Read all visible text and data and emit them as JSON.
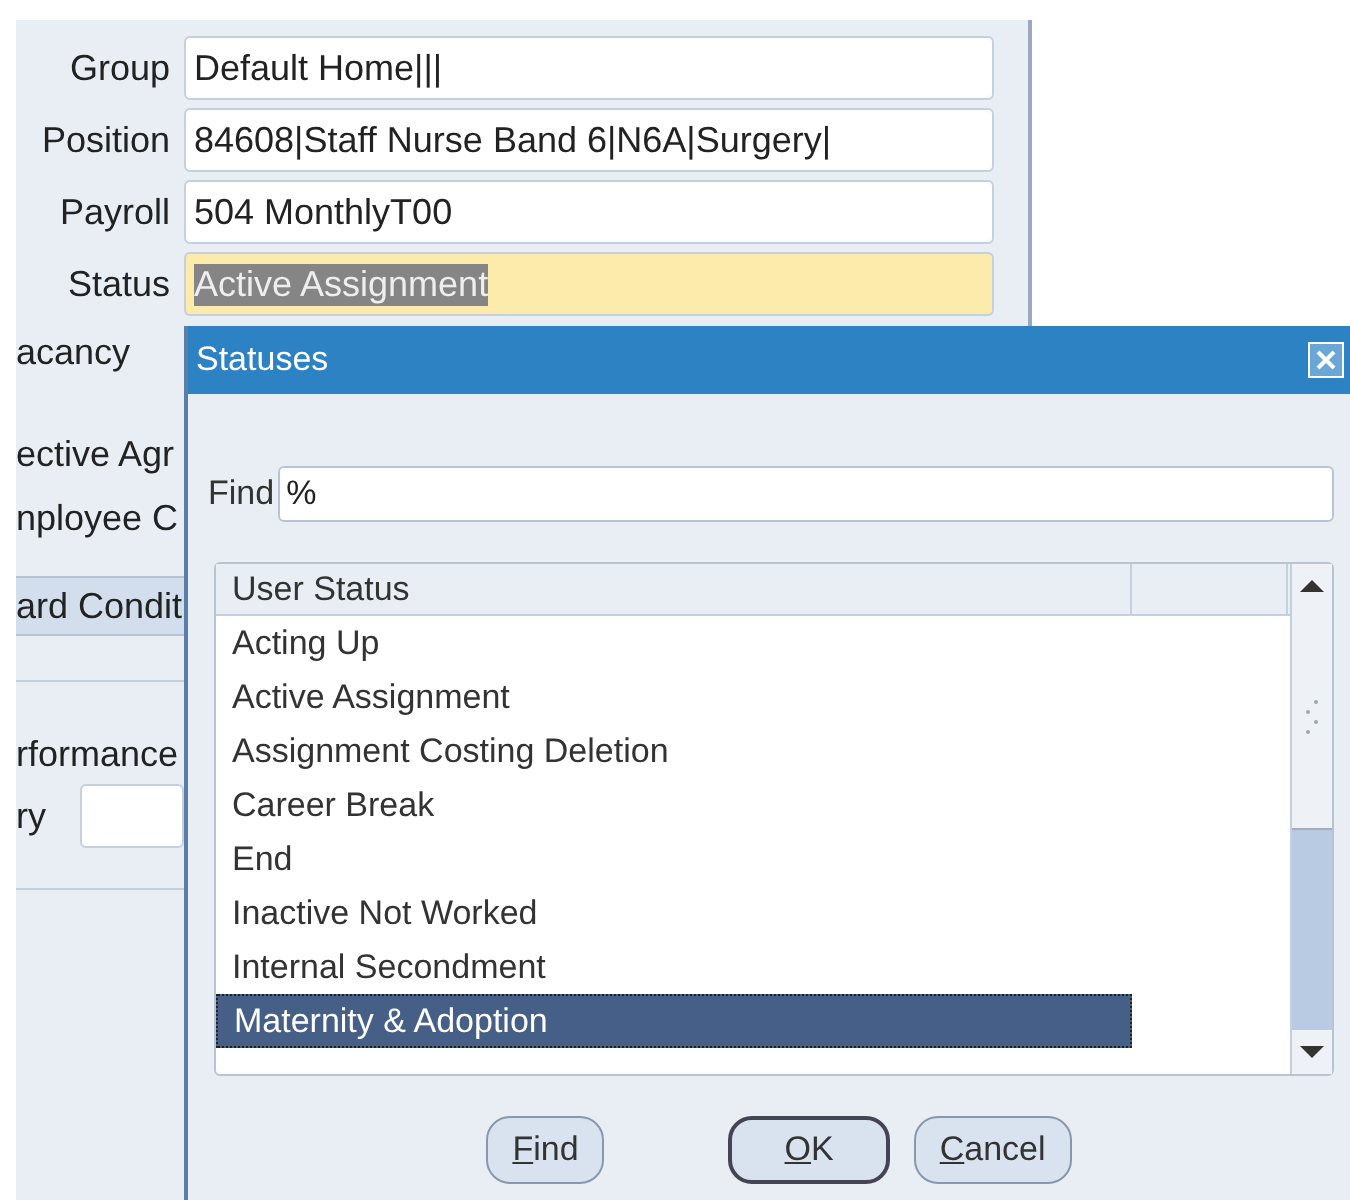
{
  "form": {
    "fields": [
      {
        "label": "Group",
        "value": "Default Home|||",
        "focused": false
      },
      {
        "label": "Position",
        "value": "84608|Staff Nurse Band 6|N6A|Surgery|",
        "focused": false
      },
      {
        "label": "Payroll",
        "value": "504 MonthlyT00",
        "focused": false
      },
      {
        "label": "Status",
        "value": "Active Assignment",
        "focused": true
      }
    ],
    "hidden_labels": [
      "acancy",
      "ective Agr",
      "nployee C"
    ],
    "tab": "ard Condit",
    "section_label": "rformance",
    "field_label": "ry"
  },
  "dialog": {
    "title": "Statuses",
    "find": {
      "label": "Find",
      "value": "%"
    },
    "list": {
      "columns": [
        "User Status"
      ],
      "rows": [
        {
          "text": "Acting Up",
          "selected": false
        },
        {
          "text": "Active Assignment",
          "selected": false
        },
        {
          "text": "Assignment Costing Deletion",
          "selected": false
        },
        {
          "text": "Career Break",
          "selected": false
        },
        {
          "text": "End",
          "selected": false
        },
        {
          "text": "Inactive Not Worked",
          "selected": false
        },
        {
          "text": "Internal Secondment",
          "selected": false
        },
        {
          "text": "Maternity & Adoption",
          "selected": true
        }
      ]
    },
    "buttons": [
      {
        "label": "Find",
        "default": false
      },
      {
        "label": "OK",
        "default": true
      },
      {
        "label": "Cancel",
        "default": false
      }
    ]
  }
}
